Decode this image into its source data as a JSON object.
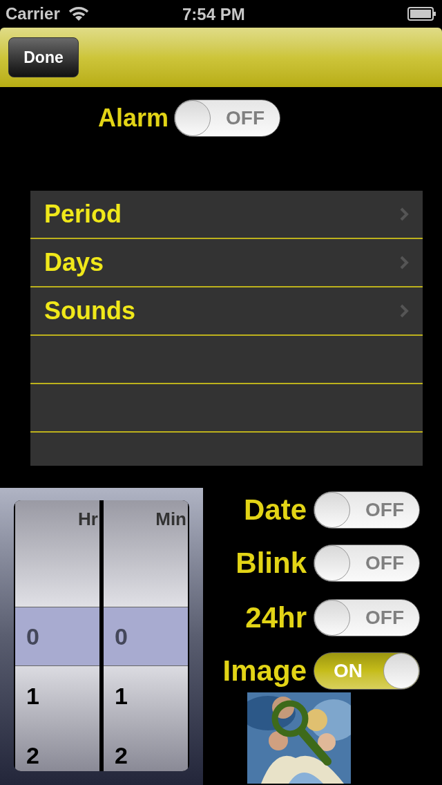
{
  "status_bar": {
    "carrier": "Carrier",
    "time": "7:54 PM"
  },
  "nav_bar": {
    "done_button": "Done"
  },
  "alarm": {
    "label": "Alarm",
    "on": false,
    "state_text": "OFF"
  },
  "menu": [
    {
      "label": "Period"
    },
    {
      "label": "Days"
    },
    {
      "label": "Sounds"
    }
  ],
  "picker": {
    "columns": [
      {
        "label": "Hr",
        "values": [
          {
            "text": "0",
            "selected": true
          },
          {
            "text": "1",
            "selected": false
          },
          {
            "text": "2",
            "selected": false
          }
        ]
      },
      {
        "label": "Min",
        "values": [
          {
            "text": "0",
            "selected": true
          },
          {
            "text": "1",
            "selected": false
          },
          {
            "text": "2",
            "selected": false
          }
        ]
      }
    ]
  },
  "options": [
    {
      "label": "Date",
      "on": false,
      "state_text": "OFF"
    },
    {
      "label": "Blink",
      "on": false,
      "state_text": "OFF"
    },
    {
      "label": "24hr",
      "on": false,
      "state_text": "OFF"
    },
    {
      "label": "Image",
      "on": true,
      "state_text": "ON"
    }
  ]
}
